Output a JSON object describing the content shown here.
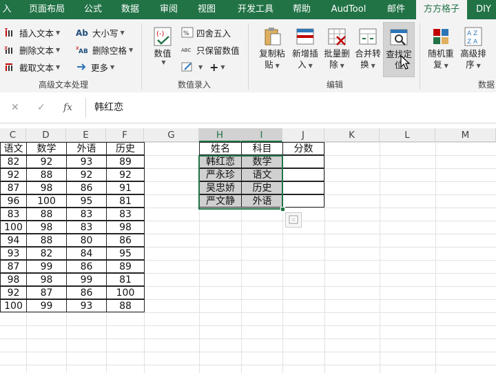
{
  "tabs": [
    "入",
    "页面布局",
    "公式",
    "数据",
    "审阅",
    "视图",
    "开发工具",
    "帮助",
    "AudTool",
    "邮件",
    "方方格子",
    "DIY"
  ],
  "active_tab": "方方格子",
  "ribbon": {
    "text_group": {
      "label": "高级文本处理",
      "buttons": [
        "插入文本",
        "删除文本",
        "截取文本",
        "大小写",
        "删除空格",
        "更多"
      ]
    },
    "entry_group": {
      "label": "数值录入",
      "numeric_label": "数值",
      "round_label": "四舍五入",
      "keep_label": "只保留数值"
    },
    "edit_group": {
      "label": "编辑",
      "buttons": [
        {
          "l1": "复制粘",
          "l2": "贴"
        },
        {
          "l1": "新增插",
          "l2": "入"
        },
        {
          "l1": "批量删",
          "l2": "除"
        },
        {
          "l1": "合并转",
          "l2": "换"
        },
        {
          "l1": "查找定",
          "l2": "位"
        }
      ]
    },
    "data_group": {
      "label": "数据",
      "buttons": [
        {
          "l1": "随机重",
          "l2": "复"
        },
        {
          "l1": "高级排",
          "l2": "序"
        }
      ]
    }
  },
  "formula_bar": {
    "cancel": "✕",
    "enter": "✓",
    "fx": "fx",
    "value": "韩红恋"
  },
  "columns": [
    "C",
    "D",
    "E",
    "F",
    "G",
    "H",
    "I",
    "J",
    "K",
    "L",
    "M"
  ],
  "score_table": {
    "headers": [
      "语文",
      "数学",
      "外语",
      "历史"
    ],
    "rows": [
      [
        "82",
        "92",
        "93",
        "89"
      ],
      [
        "92",
        "88",
        "92",
        "92"
      ],
      [
        "87",
        "98",
        "86",
        "91"
      ],
      [
        "96",
        "100",
        "95",
        "81"
      ],
      [
        "83",
        "88",
        "83",
        "83"
      ],
      [
        "100",
        "98",
        "83",
        "98"
      ],
      [
        "94",
        "88",
        "80",
        "86"
      ],
      [
        "93",
        "82",
        "84",
        "95"
      ],
      [
        "87",
        "99",
        "86",
        "89"
      ],
      [
        "98",
        "98",
        "99",
        "81"
      ],
      [
        "92",
        "87",
        "86",
        "100"
      ],
      [
        "100",
        "99",
        "93",
        "88"
      ]
    ]
  },
  "lookup_table": {
    "headers": [
      "姓名",
      "科目",
      "分数"
    ],
    "rows": [
      [
        "韩红恋",
        "数学",
        ""
      ],
      [
        "严永珍",
        "语文",
        ""
      ],
      [
        "吴忠娇",
        "历史",
        ""
      ],
      [
        "严文静",
        "外语",
        ""
      ]
    ]
  },
  "colors": {
    "accent": "#217346",
    "selection_grey": "#d0d0d0"
  }
}
